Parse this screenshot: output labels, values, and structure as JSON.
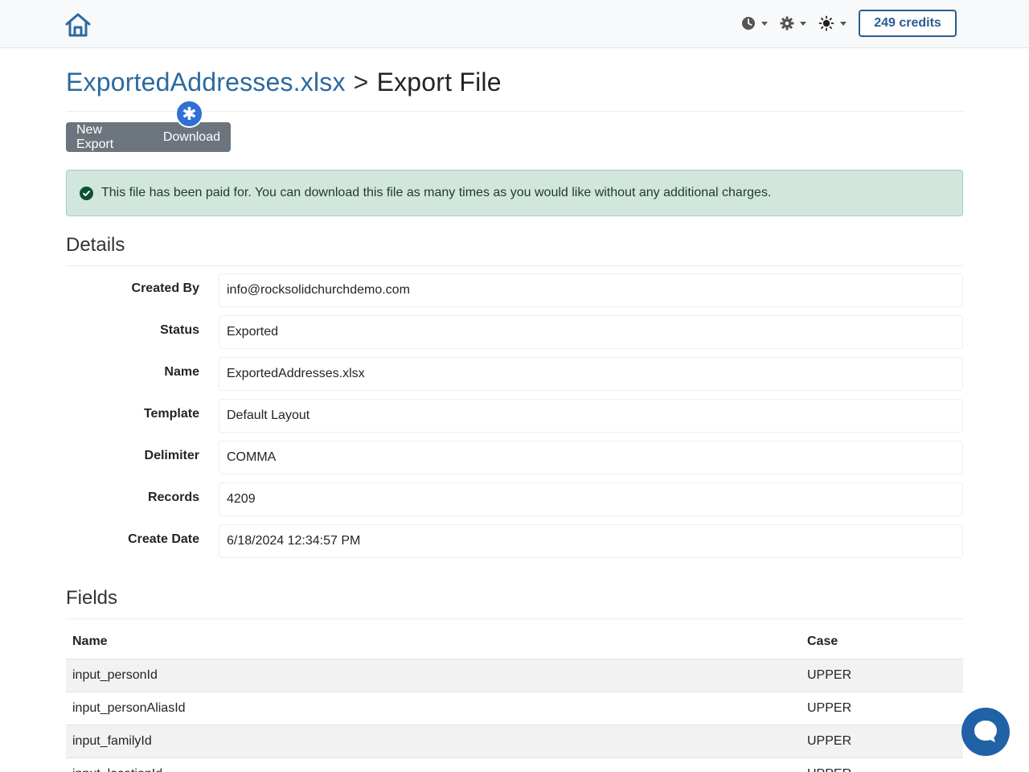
{
  "navbar": {
    "credits_label": "249 credits",
    "icons": [
      "home-icon",
      "clock-icon",
      "gear-icon",
      "sun-icon"
    ],
    "accent_color": "#2a5d8f"
  },
  "header": {
    "breadcrumb_link": "ExportedAddresses.xlsx",
    "separator": ">",
    "title": "Export File"
  },
  "toolbar": {
    "new_export_label": "New Export",
    "download_label": "Download"
  },
  "alert": {
    "message": "This file has been paid for. You can download this file as many times as you would like without any additional charges.",
    "color": "#d1e7dd"
  },
  "details": {
    "title": "Details",
    "rows": [
      {
        "label": "Created By",
        "value": "info@rocksolidchurchdemo.com"
      },
      {
        "label": "Status",
        "value": "Exported"
      },
      {
        "label": "Name",
        "value": "ExportedAddresses.xlsx"
      },
      {
        "label": "Template",
        "value": "Default Layout"
      },
      {
        "label": "Delimiter",
        "value": "COMMA"
      },
      {
        "label": "Records",
        "value": "4209"
      },
      {
        "label": "Create Date",
        "value": "6/18/2024 12:34:57 PM"
      }
    ]
  },
  "fields": {
    "title": "Fields",
    "columns": [
      "Name",
      "Case"
    ],
    "rows": [
      {
        "name": "input_personId",
        "case": "UPPER"
      },
      {
        "name": "input_personAliasId",
        "case": "UPPER"
      },
      {
        "name": "input_familyId",
        "case": "UPPER"
      },
      {
        "name": "input_locationId",
        "case": "UPPER"
      }
    ]
  }
}
